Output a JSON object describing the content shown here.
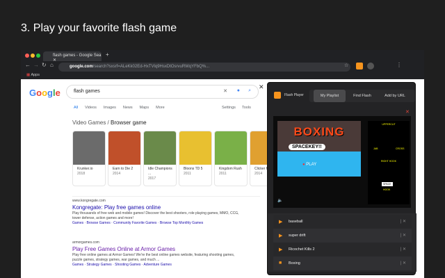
{
  "headline": "3. Play your favorite flash game",
  "browser": {
    "tab_title": "flash games - Google Sea",
    "url_domain": "google.com",
    "url_path": "/search?sxsrf=ALeKk02Ed-HxTVlq9HsxDtOsrvuRWqYFbQ%...",
    "bookmark": "Apps"
  },
  "google": {
    "query": "flash games",
    "tabs": [
      "All",
      "Videos",
      "Images",
      "News",
      "Maps",
      "More"
    ],
    "settings": "Settings",
    "tools": "Tools",
    "section_category": "Video Games",
    "section_title": "Browser game",
    "cards": [
      {
        "title": "Krunker.io",
        "year": "2018",
        "color": "#6b6b6b"
      },
      {
        "title": "Earn to Die 2",
        "year": "2014",
        "color": "#c0502a"
      },
      {
        "title": "Idle Champions ...",
        "year": "2017",
        "color": "#6a8a4a"
      },
      {
        "title": "Bloons TD 5",
        "year": "2011",
        "color": "#e8c030"
      },
      {
        "title": "Kingdom Rush",
        "year": "2011",
        "color": "#7ab048"
      },
      {
        "title": "Clicker Heroes",
        "year": "2014",
        "color": "#e0a030"
      }
    ],
    "results": [
      {
        "url": "www.kongregate.com",
        "title": "Kongregate: Play free games online",
        "snippet": "Play thousands of free web and mobile games! Discover the best shooters, role playing games, MMO, CCG, tower defense, action games and more!",
        "links": "Games · Browse Games · Community Favorite Games · Browse Top Monthly Games"
      },
      {
        "url": "armorgames.com",
        "title": "Play Free Games Online at Armor Games",
        "snippet": "Play free online games at Armor Games! We're the best online games website, featuring shooting games, puzzle games, strategy games, war games, and much ...",
        "links": "Games · Strategy Games · Shooting Games · Adventure Games"
      }
    ]
  },
  "popup": {
    "app_name": "Flash Player",
    "tabs": [
      "My Playlist",
      "Find Flash",
      "Add by URL"
    ],
    "game": {
      "title": "BOXING",
      "bubble": "SPACEKEY!!",
      "play": "PLAY",
      "controls": [
        "UPPERCUT",
        "JAB",
        "CROSS",
        "RIGHT HOOK",
        "SPACE",
        "HOOK"
      ]
    },
    "playlist": [
      {
        "name": "baseball",
        "state": "play"
      },
      {
        "name": "super drift",
        "state": "play"
      },
      {
        "name": "Ricochet Kills 2",
        "state": "play"
      },
      {
        "name": "Boxing",
        "state": "playing"
      }
    ]
  },
  "colors": {
    "accent": "#f7941d",
    "close": "#e0463a"
  }
}
